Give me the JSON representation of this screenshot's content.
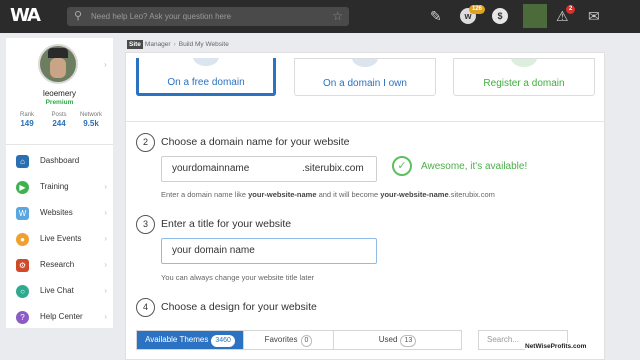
{
  "topbar": {
    "logo_text": "WA",
    "search_placeholder": "Need help Leo? Ask your question here",
    "coin_count": "126",
    "notifications_count": "2",
    "dollar_symbol": "$"
  },
  "profile": {
    "username": "leoemery",
    "rank_label": "Premium",
    "stats": [
      {
        "label": "Rank",
        "value": "149"
      },
      {
        "label": "Posts",
        "value": "244"
      },
      {
        "label": "Network",
        "value": "9.5k"
      }
    ]
  },
  "nav": [
    {
      "label": "Dashboard",
      "icon": "home-icon",
      "color": "#2b6fb3",
      "has_chevron": false
    },
    {
      "label": "Training",
      "icon": "play-icon",
      "color": "#3fb24f",
      "has_chevron": true
    },
    {
      "label": "Websites",
      "icon": "websites-icon",
      "color": "#5aa6e0",
      "has_chevron": true
    },
    {
      "label": "Live Events",
      "icon": "events-icon",
      "color": "#f0a030",
      "has_chevron": true
    },
    {
      "label": "Research",
      "icon": "research-icon",
      "color": "#d04a2a",
      "has_chevron": true
    },
    {
      "label": "Live Chat",
      "icon": "chat-icon",
      "color": "#2eaa8f",
      "has_chevron": true
    },
    {
      "label": "Help Center",
      "icon": "help-icon",
      "color": "#8a5cc4",
      "has_chevron": true
    }
  ],
  "breadcrumb": {
    "site_badge": "Site",
    "manager": "Manager",
    "current": "Build My Website"
  },
  "domain_options": [
    {
      "label": "On a free domain",
      "selected": true
    },
    {
      "label": "On a domain I own",
      "selected": false
    },
    {
      "label": "Register a domain",
      "selected": false
    }
  ],
  "step2": {
    "number": "2",
    "title": "Choose a domain name for your website",
    "input_value": "yourdomainname",
    "suffix": ".siterubix.com",
    "status": "Awesome, it's available!",
    "help_pre": "Enter a domain name like ",
    "help_bold1": "your-website-name",
    "help_mid": " and it will become ",
    "help_bold2": "your-website-name",
    "help_post": ".siterubix.com"
  },
  "step3": {
    "number": "3",
    "title": "Enter a title for your website",
    "input_value": "your domain name",
    "help": "You can always change your website title later"
  },
  "step4": {
    "number": "4",
    "title": "Choose a design for your website",
    "tabs": [
      {
        "label": "Available Themes",
        "count": "3460"
      },
      {
        "label": "Favorites",
        "count": "0"
      },
      {
        "label": "Used",
        "count": "13"
      }
    ],
    "search_placeholder": "Search..."
  },
  "watermark": "NetWiseProfits.com",
  "colors": {
    "accent": "#2b72c2",
    "success": "#4cae4c",
    "premium": "#2eaa47"
  }
}
